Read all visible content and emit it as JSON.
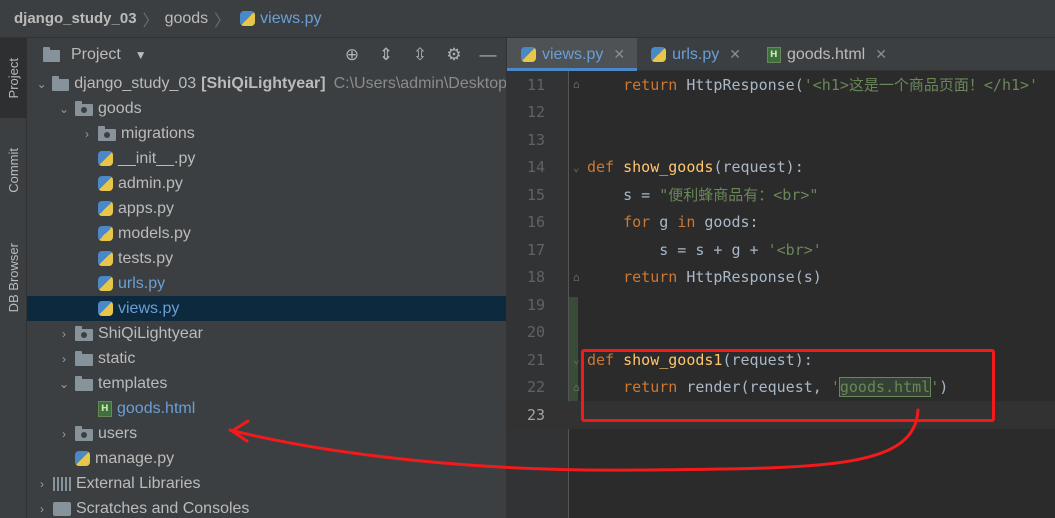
{
  "breadcrumb": {
    "project": "django_study_03",
    "folder": "goods",
    "file": "views.py"
  },
  "toolstrip": {
    "project_tab": "Project",
    "commit_tab": "Commit",
    "db_tab": "DB Browser"
  },
  "project_panel": {
    "title": "Project",
    "root_name": "django_study_03",
    "root_bold": "[ShiQiLightyear]",
    "root_path": "C:\\Users\\admin\\Desktop",
    "items": [
      {
        "label": "goods"
      },
      {
        "label": "migrations"
      },
      {
        "label": "__init__.py"
      },
      {
        "label": "admin.py"
      },
      {
        "label": "apps.py"
      },
      {
        "label": "models.py"
      },
      {
        "label": "tests.py"
      },
      {
        "label": "urls.py"
      },
      {
        "label": "views.py"
      },
      {
        "label": "ShiQiLightyear"
      },
      {
        "label": "static"
      },
      {
        "label": "templates"
      },
      {
        "label": "goods.html"
      },
      {
        "label": "users"
      },
      {
        "label": "manage.py"
      },
      {
        "label": "External Libraries"
      },
      {
        "label": "Scratches and Consoles"
      }
    ]
  },
  "editor": {
    "tabs": [
      {
        "label": "views.py"
      },
      {
        "label": "urls.py"
      },
      {
        "label": "goods.html"
      }
    ],
    "lines": [
      {
        "num": "11",
        "parts": [
          "    ",
          "return",
          " HttpResponse(",
          "'<h1>这是一个商品页面！</h1>'"
        ]
      },
      {
        "num": "12"
      },
      {
        "num": "13"
      },
      {
        "num": "14",
        "parts": [
          "def",
          " ",
          "show_goods",
          "(request):"
        ]
      },
      {
        "num": "15",
        "parts": [
          "    s = ",
          "\"便利蜂商品有：<br>\""
        ]
      },
      {
        "num": "16",
        "parts": [
          "    ",
          "for",
          " g ",
          "in",
          " goods:"
        ]
      },
      {
        "num": "17",
        "parts": [
          "        s = s + g + ",
          "'<br>'"
        ]
      },
      {
        "num": "18",
        "parts": [
          "    ",
          "return",
          " HttpResponse(s)"
        ]
      },
      {
        "num": "19"
      },
      {
        "num": "20"
      },
      {
        "num": "21",
        "parts": [
          "def",
          " ",
          "show_goods1",
          "(request):"
        ]
      },
      {
        "num": "22",
        "parts": [
          "    ",
          "return",
          " render(request, ",
          "'",
          "goods.html",
          "'",
          ")"
        ]
      },
      {
        "num": "23"
      }
    ]
  },
  "colors": {
    "keyword": "#cc7832",
    "function": "#ffc66d",
    "string": "#6a8759",
    "annotation": "#f21a1a"
  }
}
